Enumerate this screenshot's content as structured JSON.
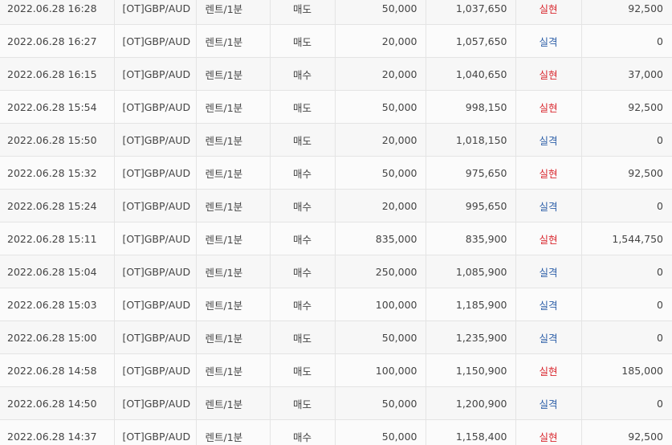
{
  "colors": {
    "win": "#d9272e",
    "loss": "#2d5fa8"
  },
  "rows": [
    {
      "time": "2022.06.28 16:28",
      "symbol": "[OT]GBP/AUD",
      "type": "렌트/1분",
      "side": "매도",
      "amount": "50,000",
      "balance": "1,037,650",
      "result": "실현",
      "profit": "92,500"
    },
    {
      "time": "2022.06.28 16:27",
      "symbol": "[OT]GBP/AUD",
      "type": "렌트/1분",
      "side": "매도",
      "amount": "20,000",
      "balance": "1,057,650",
      "result": "실격",
      "profit": "0"
    },
    {
      "time": "2022.06.28 16:15",
      "symbol": "[OT]GBP/AUD",
      "type": "렌트/1분",
      "side": "매수",
      "amount": "20,000",
      "balance": "1,040,650",
      "result": "실현",
      "profit": "37,000"
    },
    {
      "time": "2022.06.28 15:54",
      "symbol": "[OT]GBP/AUD",
      "type": "렌트/1분",
      "side": "매도",
      "amount": "50,000",
      "balance": "998,150",
      "result": "실현",
      "profit": "92,500"
    },
    {
      "time": "2022.06.28 15:50",
      "symbol": "[OT]GBP/AUD",
      "type": "렌트/1분",
      "side": "매도",
      "amount": "20,000",
      "balance": "1,018,150",
      "result": "실격",
      "profit": "0"
    },
    {
      "time": "2022.06.28 15:32",
      "symbol": "[OT]GBP/AUD",
      "type": "렌트/1분",
      "side": "매수",
      "amount": "50,000",
      "balance": "975,650",
      "result": "실현",
      "profit": "92,500"
    },
    {
      "time": "2022.06.28 15:24",
      "symbol": "[OT]GBP/AUD",
      "type": "렌트/1분",
      "side": "매수",
      "amount": "20,000",
      "balance": "995,650",
      "result": "실격",
      "profit": "0"
    },
    {
      "time": "2022.06.28 15:11",
      "symbol": "[OT]GBP/AUD",
      "type": "렌트/1분",
      "side": "매수",
      "amount": "835,000",
      "balance": "835,900",
      "result": "실현",
      "profit": "1,544,750"
    },
    {
      "time": "2022.06.28 15:04",
      "symbol": "[OT]GBP/AUD",
      "type": "렌트/1분",
      "side": "매수",
      "amount": "250,000",
      "balance": "1,085,900",
      "result": "실격",
      "profit": "0"
    },
    {
      "time": "2022.06.28 15:03",
      "symbol": "[OT]GBP/AUD",
      "type": "렌트/1분",
      "side": "매수",
      "amount": "100,000",
      "balance": "1,185,900",
      "result": "실격",
      "profit": "0"
    },
    {
      "time": "2022.06.28 15:00",
      "symbol": "[OT]GBP/AUD",
      "type": "렌트/1분",
      "side": "매도",
      "amount": "50,000",
      "balance": "1,235,900",
      "result": "실격",
      "profit": "0"
    },
    {
      "time": "2022.06.28 14:58",
      "symbol": "[OT]GBP/AUD",
      "type": "렌트/1분",
      "side": "매도",
      "amount": "100,000",
      "balance": "1,150,900",
      "result": "실현",
      "profit": "185,000"
    },
    {
      "time": "2022.06.28 14:50",
      "symbol": "[OT]GBP/AUD",
      "type": "렌트/1분",
      "side": "매도",
      "amount": "50,000",
      "balance": "1,200,900",
      "result": "실격",
      "profit": "0"
    },
    {
      "time": "2022.06.28 14:37",
      "symbol": "[OT]GBP/AUD",
      "type": "렌트/1분",
      "side": "매수",
      "amount": "50,000",
      "balance": "1,158,400",
      "result": "실현",
      "profit": "92,500"
    }
  ]
}
